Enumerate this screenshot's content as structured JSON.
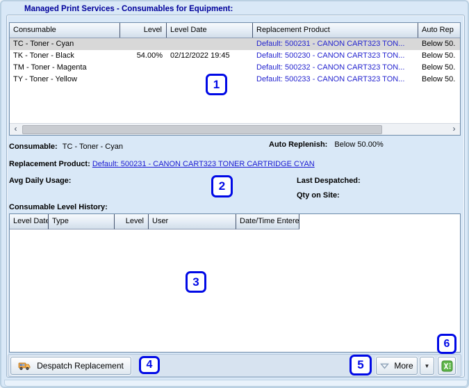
{
  "window": {
    "group_title": "Managed Print Services - Consumables for Equipment:"
  },
  "consumables_table": {
    "columns": {
      "consumable": "Consumable",
      "level": "Level",
      "level_date": "Level Date",
      "replacement": "Replacement Product",
      "auto_rep": "Auto Rep"
    },
    "rows": [
      {
        "consumable": "TC - Toner - Cyan",
        "level": "",
        "level_date": "",
        "replacement": "Default: 500231 - CANON CART323 TON...",
        "auto_rep": "Below 50.",
        "selected": true
      },
      {
        "consumable": "TK - Toner - Black",
        "level": "54.00%",
        "level_date": "02/12/2022 19:45",
        "replacement": "Default: 500230 - CANON CART323 TON...",
        "auto_rep": "Below 50.",
        "selected": false
      },
      {
        "consumable": "TM - Toner - Magenta",
        "level": "",
        "level_date": "",
        "replacement": "Default: 500232 - CANON CART323 TON...",
        "auto_rep": "Below 50.",
        "selected": false
      },
      {
        "consumable": "TY - Toner - Yellow",
        "level": "",
        "level_date": "",
        "replacement": "Default: 500233 - CANON CART323 TON...",
        "auto_rep": "Below 50.",
        "selected": false
      }
    ]
  },
  "details": {
    "consumable_label": "Consumable:",
    "consumable_value": "TC - Toner - Cyan",
    "auto_replenish_label": "Auto Replenish:",
    "auto_replenish_value": "Below 50.00%",
    "replacement_product_label": "Replacement Product:",
    "replacement_product_link": "Default: 500231 - CANON CART323 TONER CARTRIDGE CYAN",
    "avg_daily_usage_label": "Avg Daily Usage:",
    "last_despatched_label": "Last Despatched:",
    "qty_on_site_label": "Qty on Site:"
  },
  "history": {
    "label": "Consumable Level History:",
    "columns": {
      "level_date": "Level Date",
      "type": "Type",
      "level": "Level",
      "user": "User",
      "datetime_entered": "Date/Time Entered"
    },
    "rows": []
  },
  "toolbar": {
    "despatch_label": "Despatch Replacement",
    "more_label": "More"
  },
  "icons": {
    "scroll_left": "‹",
    "scroll_right": "›",
    "more_dropdown": "▼"
  },
  "annotations": {
    "a1": "1",
    "a2": "2",
    "a3": "3",
    "a4": "4",
    "a5": "5",
    "a6": "6"
  },
  "colors": {
    "annotation_blue": "#0009e6",
    "link_blue": "#1919d2",
    "title_navy": "#00009b",
    "replacement_text": "#2424cf",
    "excel_green": "#5fb54a",
    "truck_orange": "#f5a33b"
  }
}
